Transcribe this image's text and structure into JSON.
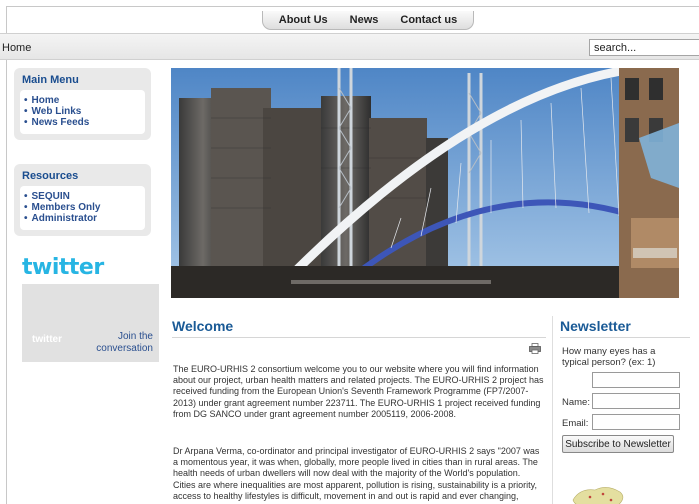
{
  "topnav": {
    "items": [
      "About Us",
      "News",
      "Contact us"
    ]
  },
  "breadcrumb": "Home",
  "search": {
    "value": "search..."
  },
  "main_menu": {
    "title": "Main Menu",
    "items": [
      "Home",
      "Web Links",
      "News Feeds"
    ]
  },
  "resources": {
    "title": "Resources",
    "items": [
      "SEQUIN",
      "Members Only",
      "Administrator"
    ]
  },
  "twitter": {
    "logo_text": "twitter",
    "small_logo": "twitter",
    "join_text": "Join the conversation"
  },
  "welcome": {
    "title": "Welcome",
    "para1": "The EURO-URHIS 2 consortium welcome you to our website where you will find information about our project, urban health matters and related projects. The EURO-URHIS 2 project has received funding from the European Union's Seventh Framework Programme (FP7/2007-2013) under grant agreement number 223711. The EURO-URHIS 1 project received funding from DG SANCO under grant agreement number 2005119, 2006-2008.",
    "para2": "Dr Arpana Verma, co-ordinator and principal investigator of EURO-URHIS 2 says \"2007 was a momentous year, it was when, globally, more people lived in cities than in rural areas. The health needs of urban dwellers will now deal with the majority of the World's population. Cities are where inequalities are most apparent, pollution is rising, sustainability is a priority, access to healthy lifestyles is difficult, movement in and out is rapid and ever changing,"
  },
  "newsletter": {
    "title": "Newsletter",
    "question": "How many eyes has a typical person? (ex: 1)",
    "name_label": "Name:",
    "email_label": "Email:",
    "subscribe_label": "Subscribe to Newsletter"
  },
  "colors": {
    "heading_blue": "#1a5a96",
    "twitter_blue": "#27b5e3",
    "link_blue": "#2a4f8f"
  }
}
